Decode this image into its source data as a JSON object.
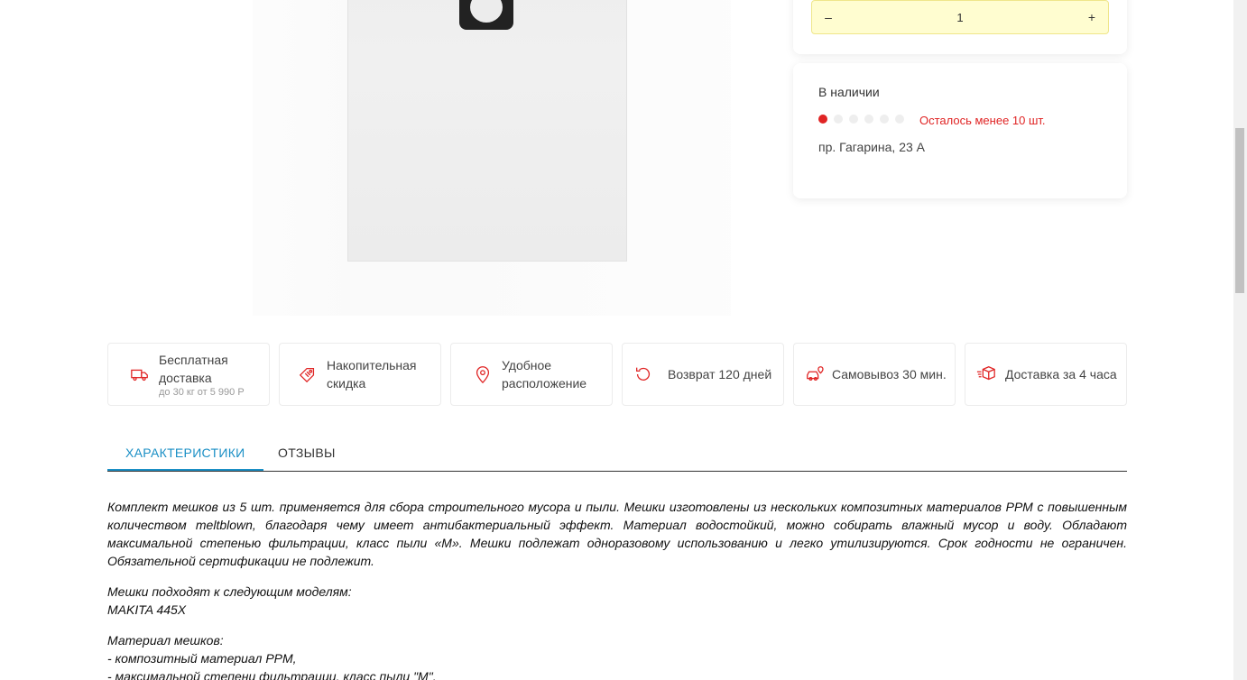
{
  "quantity": {
    "minus_label": "–",
    "value": "1",
    "plus_label": "+"
  },
  "stock": {
    "title": "В наличии",
    "level_filled": 1,
    "level_total": 6,
    "warning": "Осталось менее 10 шт.",
    "address": "пр. Гагарина, 23 А"
  },
  "features": [
    {
      "icon": "truck-icon",
      "label": "Бесплатная доставка",
      "sub": "до 30 кг от 5 990 Р"
    },
    {
      "icon": "tag-icon",
      "label": "Накопительная скидка"
    },
    {
      "icon": "location-pin-icon",
      "label": "Удобное расположение"
    },
    {
      "icon": "return-icon",
      "label": "Возврат 120 дней"
    },
    {
      "icon": "car-pickup-icon",
      "label": "Самовывоз 30 мин."
    },
    {
      "icon": "box-delivery-icon",
      "label": "Доставка за 4 часа"
    }
  ],
  "tabs": {
    "characteristics": "ХАРАКТЕРИСТИКИ",
    "reviews": "ОТЗЫВЫ"
  },
  "description": {
    "p1": "Комплект мешков из 5 шт. применяется для сбора строительного мусора и пыли. Мешки изготовлены из нескольких композитных материалов РРМ с повышенным количеством meltblown, благодаря чему имеет антибактериальный эффект. Материал водостойкий, можно собирать влажный мусор и воду. Обладают максимальной степенью фильтрации, класс пыли «М». Мешки подлежат одноразовому использованию и легко утилизируются. Срок годности не ограничен. Обязательной сертификации не подлежит.",
    "models_title": "Мешки подходят к следующим моделям:",
    "model_1": "MAKITA 445X",
    "material_title": "Материал мешков:",
    "material_1": "- композитный материал PPM,",
    "material_2": "- максимальной степени фильтрации, класс пыли \"M\","
  },
  "colors": {
    "accent": "#1a8fc5",
    "warning": "#e02424",
    "qty_bg": "#fffdd0"
  }
}
